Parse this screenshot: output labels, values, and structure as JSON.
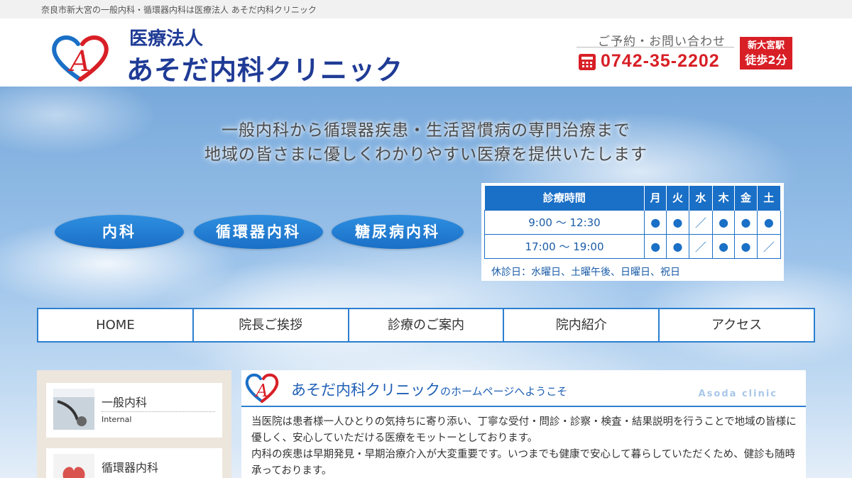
{
  "topbar": {
    "text": "奈良市新大宮の一般内科・循環器内科は医療法人 あそだ内科クリニック"
  },
  "header": {
    "clinic_sub": "医療法人",
    "clinic_name": "あそだ内科クリニック",
    "contact_label": "ご予約・お問い合わせ",
    "phone": "0742-35-2202",
    "station_line1": "新大宮駅",
    "station_line2": "徒歩2分",
    "logo_letter": "A"
  },
  "hero": {
    "tagline_1": "一般内科から循環器疾患・生活習慣病の専門治療まで",
    "tagline_2": "地域の皆さまに優しくわかりやすい医療を提供いたします"
  },
  "departments": [
    "内科",
    "循環器内科",
    "糖尿病内科"
  ],
  "hours": {
    "header": "診療時間",
    "days": [
      "月",
      "火",
      "水",
      "木",
      "金",
      "土"
    ],
    "rows": [
      {
        "time": "9:00 ～ 12:30",
        "marks": [
          "●",
          "●",
          "／",
          "●",
          "●",
          "●"
        ]
      },
      {
        "time": "17:00 ～ 19:00",
        "marks": [
          "●",
          "●",
          "／",
          "●",
          "●",
          "／"
        ]
      }
    ],
    "note": "休診日：水曜日、土曜午後、日曜日、祝日"
  },
  "nav": [
    "HOME",
    "院長ご挨拶",
    "診療のご案内",
    "院内紹介",
    "アクセス"
  ],
  "sidebar": [
    {
      "title": "一般内科",
      "sub": "Internal"
    },
    {
      "title": "循環器内科",
      "sub": ""
    }
  ],
  "main": {
    "heading": "あそだ内科クリニック",
    "heading_suffix": "のホームページへようこそ",
    "english": "Asoda clinic",
    "para_1": "当医院は患者様一人ひとりの気持ちに寄り添い、丁寧な受付・問診・診察・検査・結果説明を行うことで地域の皆様に優しく、安心していただける医療をモットーとしております。",
    "para_2": "内科の疾患は早期発見・早期治療介入が大変重要です。いつまでも健康で安心して暮らしていただくため、健診も随時承っております。"
  },
  "colors": {
    "brand_blue": "#1f3b96",
    "accent_blue": "#1a6fc6",
    "phone_red": "#d81f26"
  }
}
